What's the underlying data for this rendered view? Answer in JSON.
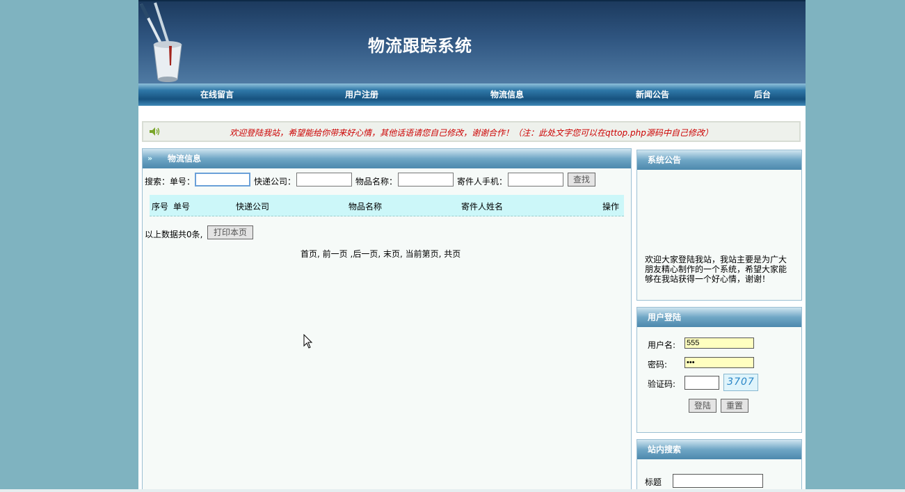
{
  "header": {
    "title": "物流跟踪系统"
  },
  "nav": {
    "items": [
      {
        "label": "在线留言"
      },
      {
        "label": "用户注册"
      },
      {
        "label": "物流信息"
      },
      {
        "label": "新闻公告"
      },
      {
        "label": "后台"
      }
    ]
  },
  "notice": {
    "text": "欢迎登陆我站，希望能给你带来好心情，其他话语请您自己修改，谢谢合作！（注：此处文字您可以在qttop.php源码中自己修改）",
    "color": "#cc0000",
    "icon": "speaker-icon"
  },
  "main": {
    "title": "物流信息",
    "search": {
      "prefix": "搜索：",
      "fields": [
        {
          "label": "单号：",
          "value": ""
        },
        {
          "label": "快递公司：",
          "value": ""
        },
        {
          "label": "物品名称：",
          "value": ""
        },
        {
          "label": "寄件人手机：",
          "value": ""
        }
      ],
      "button": "查找"
    },
    "table": {
      "headers": [
        "序号",
        "单号",
        "快递公司",
        "物品名称",
        "寄件人姓名",
        "操作"
      ],
      "rows": []
    },
    "count_text": "以上数据共0条,",
    "print_button": "打印本页",
    "pager": {
      "first": "首页,",
      "prev": "前一页",
      "next": ",后一页,",
      "last": "末页,",
      "current": "当前第页,",
      "total": "共页"
    }
  },
  "sidebar": {
    "announce": {
      "title": "系统公告",
      "text": "欢迎大家登陆我站，我站主要是为广大朋友精心制作的一个系统，希望大家能够在我站获得一个好心情，谢谢！"
    },
    "login": {
      "title": "用户登陆",
      "username_label": "用户名:",
      "username_value": "555",
      "password_label": "密码:",
      "password_value": "•••",
      "captcha_label": "验证码:",
      "captcha_value": "",
      "captcha_image": "3707",
      "login_button": "登陆",
      "reset_button": "重置"
    },
    "site_search": {
      "title": "站内搜索",
      "label": "标题",
      "value": ""
    }
  },
  "colors": {
    "background": "#7fb3c0",
    "banner": "#2f5580",
    "nav": "#16527f",
    "notice_text": "#cc0000",
    "table_header": "#ccf7f9",
    "login_input": "#ffffc0"
  }
}
